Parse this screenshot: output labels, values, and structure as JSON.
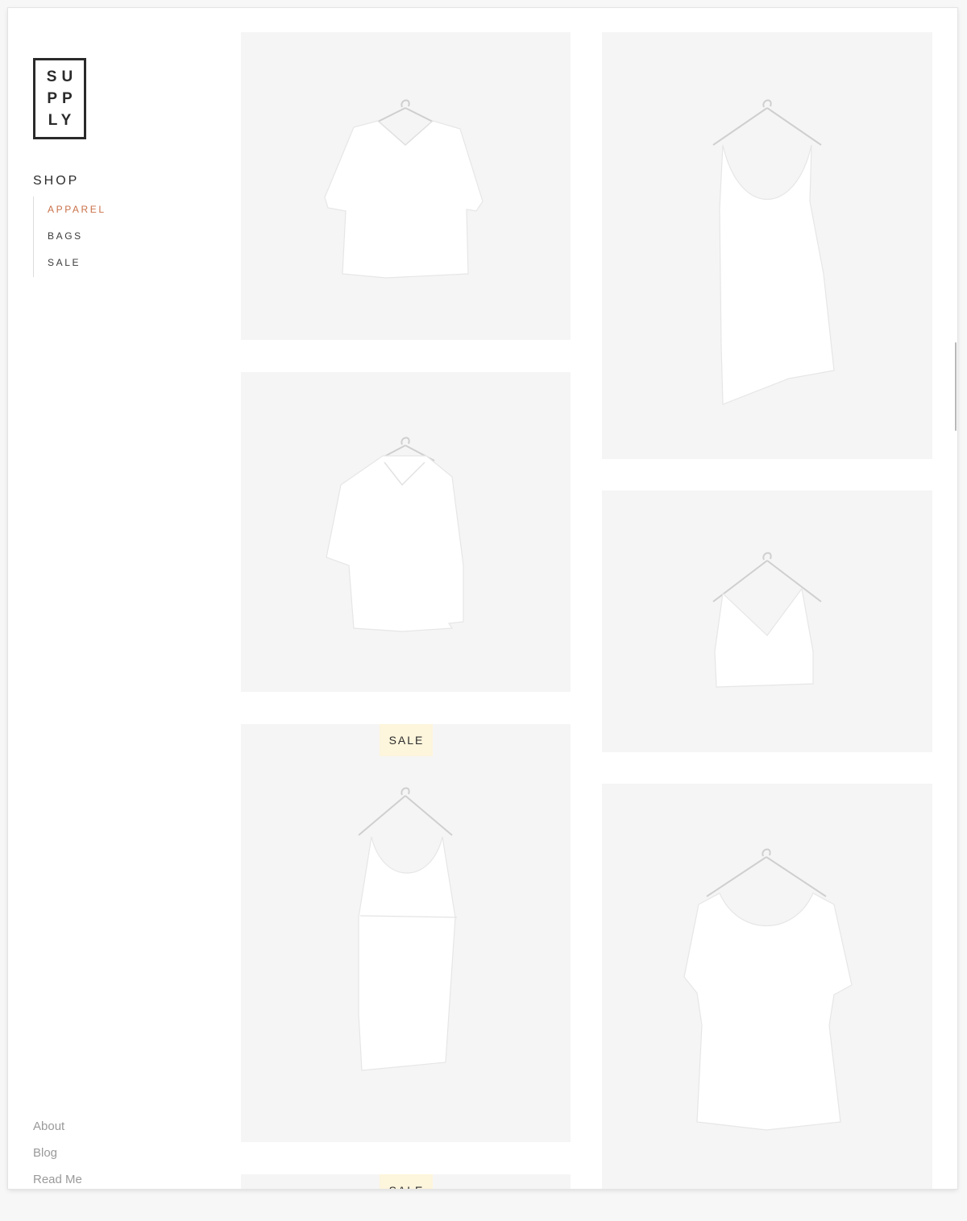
{
  "brand": {
    "logo_lines": [
      "SU",
      "PP",
      "LY"
    ]
  },
  "sidebar": {
    "heading": "SHOP",
    "nav": [
      {
        "label": "APPAREL",
        "active": true
      },
      {
        "label": "BAGS",
        "active": false
      },
      {
        "label": "SALE",
        "active": false
      }
    ],
    "footer": [
      {
        "label": "About"
      },
      {
        "label": "Blog"
      },
      {
        "label": "Read Me"
      }
    ]
  },
  "products": [
    {
      "type": "kimono-top",
      "on_sale": false
    },
    {
      "type": "trapeze-slip-dress",
      "on_sale": false
    },
    {
      "type": "collared-shirt",
      "on_sale": false
    },
    {
      "type": "cropped-tank",
      "on_sale": false
    },
    {
      "type": "layered-shift-dress",
      "on_sale": true,
      "badge": "SALE"
    },
    {
      "type": "swing-dress",
      "on_sale": false
    },
    {
      "type": "partial-item",
      "on_sale": true,
      "badge": "SALE"
    }
  ],
  "colors": {
    "accent": "#c97149",
    "sale_badge_bg": "#fdf5dc",
    "card_bg": "#f5f5f5",
    "garment": "#ffffff"
  }
}
